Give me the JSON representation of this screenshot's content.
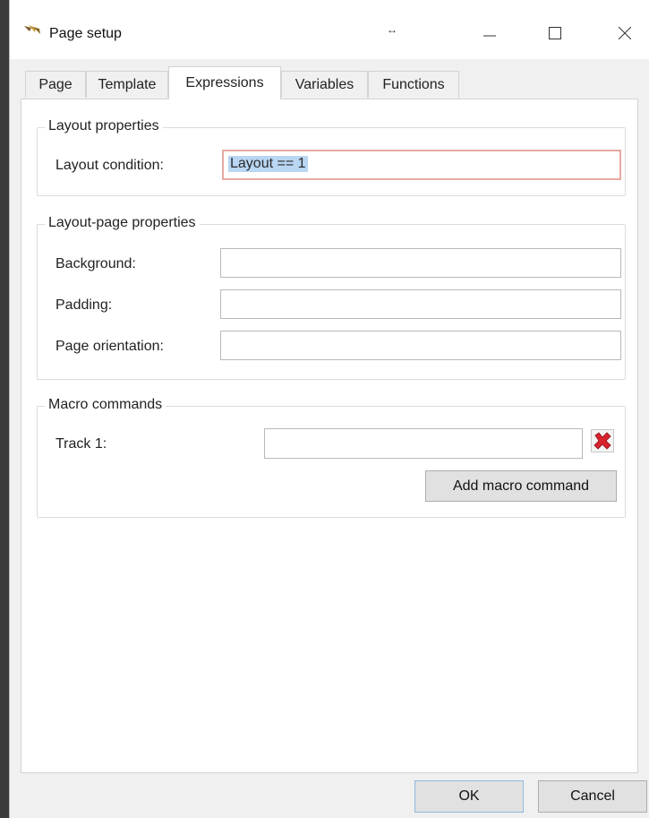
{
  "window": {
    "title": "Page setup",
    "grip": "↔"
  },
  "tabs": [
    {
      "label": "Page"
    },
    {
      "label": "Template"
    },
    {
      "label": "Expressions",
      "active": true
    },
    {
      "label": "Variables"
    },
    {
      "label": "Functions"
    }
  ],
  "layout_properties": {
    "title": "Layout properties",
    "condition_label": "Layout condition:",
    "condition_value": "Layout == 1"
  },
  "layout_page_properties": {
    "title": "Layout-page properties",
    "background_label": "Background:",
    "background_value": "",
    "padding_label": "Padding:",
    "padding_value": "",
    "orientation_label": "Page orientation:",
    "orientation_value": ""
  },
  "macro_commands": {
    "title": "Macro commands",
    "track_label": "Track 1:",
    "track_value": "",
    "add_label": "Add macro command"
  },
  "buttons": {
    "ok": "OK",
    "cancel": "Cancel"
  },
  "colors": {
    "selection": "#b9d6f3",
    "focus_border": "#e8a9a2",
    "delete_icon": "#d9232e"
  },
  "icons": {
    "app": "pen-nib-icon",
    "minimize": "minimize-icon",
    "maximize": "maximize-icon",
    "close": "close-icon",
    "delete": "red-x-delete-icon"
  }
}
